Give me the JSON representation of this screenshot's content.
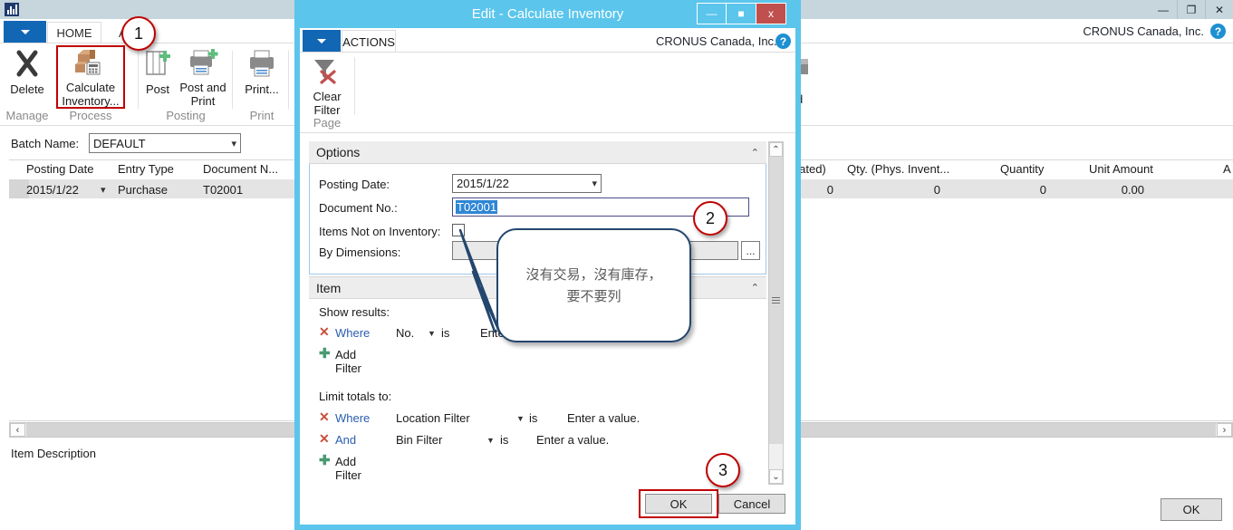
{
  "main_window": {
    "titlebar": {
      "logo_icon": "dynamics-nav-logo",
      "controls": [
        {
          "name": "minimize",
          "glyph": "—"
        },
        {
          "name": "restore",
          "glyph": "❐"
        },
        {
          "name": "close",
          "glyph": "✕"
        }
      ]
    },
    "ribbon": {
      "app_button": "file-menu-caret",
      "tabs": [
        {
          "label": "HOME",
          "active": true
        },
        {
          "label": "ACT",
          "active": false
        }
      ],
      "company": "CRONUS Canada, Inc.",
      "help_glyph": "?",
      "items": [
        {
          "label_line1": "Delete",
          "label_line2": "",
          "icon": "delete-x-icon"
        },
        {
          "label_line1": "Calculate",
          "label_line2": "Inventory...",
          "icon": "calculate-inventory-icon"
        },
        {
          "label_line1": "Post",
          "label_line2": "",
          "icon": "post-icon"
        },
        {
          "label_line1": "Post and",
          "label_line2": "Print",
          "icon": "post-and-print-icon"
        },
        {
          "label_line1": "Print...",
          "label_line2": "",
          "icon": "print-icon"
        }
      ],
      "groups": [
        {
          "label": "Manage"
        },
        {
          "label": "Process"
        },
        {
          "label": "Posting"
        },
        {
          "label": "Print"
        }
      ]
    },
    "batch": {
      "label": "Batch Name:",
      "value": "DEFAULT"
    },
    "grid": {
      "columns": [
        "Posting Date",
        "Entry Type",
        "Document N...",
        "ulated)",
        "Qty. (Phys. Invent...",
        "Quantity",
        "Unit Amount",
        "A"
      ],
      "row": {
        "posting_date": "2015/1/22",
        "entry_type": "Purchase",
        "document_no": "T02001",
        "qty_calculated": "0",
        "qty_phys_invent": "0",
        "quantity": "0",
        "unit_amount": "0.00"
      }
    },
    "footer": {
      "item_description_label": "Item Description",
      "ok_label": "OK"
    },
    "hscrollbar": {
      "left_glyph": "‹",
      "right_glyph": "›"
    }
  },
  "dialog": {
    "title": "Edit - Calculate Inventory",
    "controls": [
      {
        "name": "minimize",
        "glyph": "—"
      },
      {
        "name": "maximize",
        "glyph": "■"
      },
      {
        "name": "close",
        "glyph": "x"
      }
    ],
    "ribbon": {
      "app_button": "file-menu-caret",
      "tab_label": "ACTIONS",
      "company": "CRONUS Canada, Inc.",
      "help_glyph": "?",
      "clear_filter_line1": "Clear",
      "clear_filter_line2": "Filter",
      "group_label": "Page"
    },
    "options": {
      "header": "Options",
      "collapse_glyph": "⌃",
      "posting_date_label": "Posting Date:",
      "posting_date_value": "2015/1/22",
      "document_no_label": "Document No.:",
      "document_no_value": "T02001",
      "items_not_on_inventory_label": "Items Not on Inventory:",
      "items_not_on_inventory_checked": false,
      "by_dimensions_label": "By Dimensions:",
      "by_dimensions_value": "",
      "by_dimensions_button": "..."
    },
    "item": {
      "header": "Item",
      "collapse_glyph": "⌃",
      "show_results_label": "Show results:",
      "show_results_filters": [
        {
          "keyword": "Where",
          "field": "No.",
          "operator": "is",
          "value": "Enter a"
        }
      ],
      "show_results_add_filter": "Add Filter",
      "limit_totals_label": "Limit totals to:",
      "limit_totals_filters": [
        {
          "keyword": "Where",
          "field": "Location Filter",
          "operator": "is",
          "value": "Enter a value."
        },
        {
          "keyword": "And",
          "field": "Bin Filter",
          "operator": "is",
          "value": "Enter a value."
        }
      ],
      "limit_totals_add_filter": "Add Filter"
    },
    "footer": {
      "ok_label": "OK",
      "cancel_label": "Cancel"
    },
    "scrollbar": {
      "up_glyph": "⌃",
      "down_glyph": "⌄"
    }
  },
  "annotations": {
    "badges": [
      {
        "number": "1"
      },
      {
        "number": "2"
      },
      {
        "number": "3"
      }
    ],
    "callout_text": "沒有交易，沒有庫存，\n要不要列"
  },
  "colors": {
    "dialog_frame": "#5bc5ec",
    "accent_blue": "#1267b5",
    "close_red": "#c0504d",
    "highlight_red": "#c00000",
    "selection_blue": "#2f86d4",
    "filter_x_red": "#c9503c",
    "filter_keyword_blue": "#2a5db0",
    "plus_green": "#4a9a72",
    "titlebar_gray": "#c6d6dc"
  }
}
